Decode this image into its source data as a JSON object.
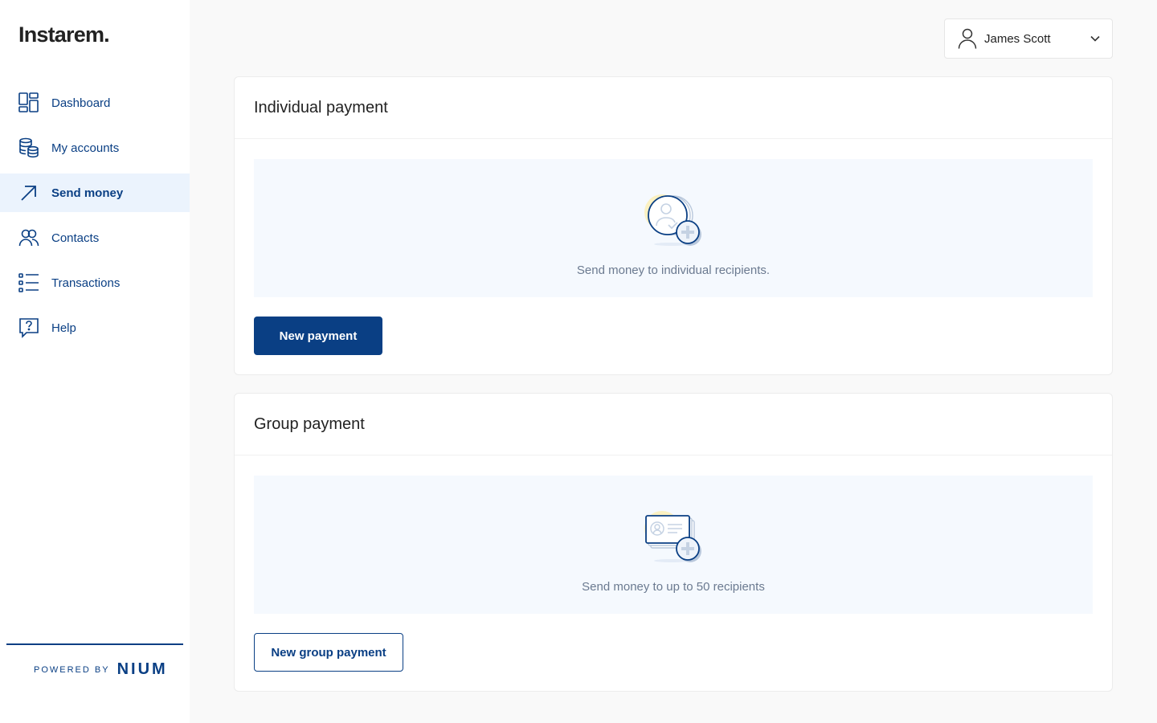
{
  "app": {
    "logo": "Instarem."
  },
  "sidebar": {
    "items": [
      {
        "label": "Dashboard",
        "icon": "dashboard-icon",
        "active": false
      },
      {
        "label": "My accounts",
        "icon": "coins-stack-icon",
        "active": false
      },
      {
        "label": "Send money",
        "icon": "arrow-up-right-icon",
        "active": true
      },
      {
        "label": "Contacts",
        "icon": "users-icon",
        "active": false
      },
      {
        "label": "Transactions",
        "icon": "list-icon",
        "active": false
      },
      {
        "label": "Help",
        "icon": "help-chat-icon",
        "active": false
      }
    ],
    "footer": {
      "powered_by": "POWERED BY",
      "brand": "NIUM"
    }
  },
  "header": {
    "user": {
      "name": "James Scott",
      "icon": "user-icon",
      "menu_icon": "chevron-down-icon"
    }
  },
  "main": {
    "individual": {
      "title": "Individual payment",
      "description": "Send money to individual recipients.",
      "button": "New payment",
      "illustration": "individual-recipient-add-illustration"
    },
    "group": {
      "title": "Group payment",
      "description": "Send money to up to 50 recipients",
      "button": "New group payment",
      "illustration": "group-recipient-add-illustration"
    }
  },
  "colors": {
    "brand": "#0a3f84",
    "active_bg": "#ebf3fd",
    "empty_bg": "#f5f9fe",
    "page_bg": "#f9f9f9"
  }
}
